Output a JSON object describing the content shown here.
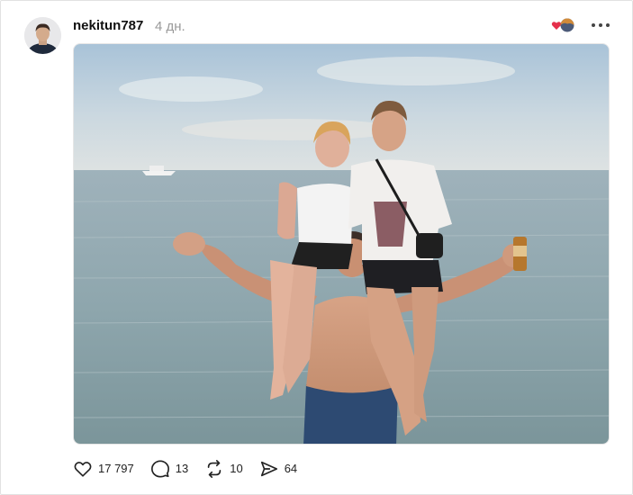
{
  "post": {
    "author": {
      "username": "nekitun787",
      "avatar_icon": "user-avatar"
    },
    "timestamp": "4 дн.",
    "reaction_icon": "reaction-badge-icon",
    "more_icon": "more-dots-icon",
    "image": {
      "description_icon": "post-photo"
    },
    "actions": {
      "likes": "17 797",
      "comments": "13",
      "reposts": "10",
      "shares": "64"
    }
  },
  "colors": {
    "text": "#111111",
    "muted": "#9a9a9a",
    "border": "#e2e2e2",
    "heart": "#e5304b"
  }
}
